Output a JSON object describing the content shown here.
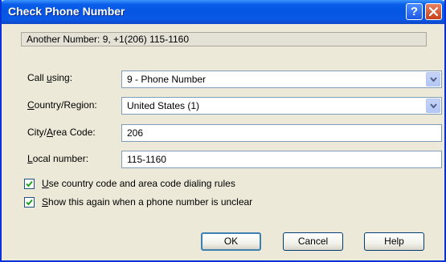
{
  "window": {
    "title": "Check Phone Number",
    "help_glyph": "?",
    "close_icon": "close-icon"
  },
  "info": {
    "text": "Another Number: 9, +1(206) 115-1160"
  },
  "form": {
    "call_using": {
      "label_pre": "Call ",
      "label_key": "u",
      "label_post": "sing:",
      "value": "9 - Phone Number"
    },
    "country": {
      "label_pre": "",
      "label_key": "C",
      "label_post": "ountry/Region:",
      "value": "United States (1)"
    },
    "area": {
      "label_pre": "City/",
      "label_key": "A",
      "label_post": "rea Code:",
      "value": "206"
    },
    "local": {
      "label_pre": "",
      "label_key": "L",
      "label_post": "ocal number:",
      "value": "115-1160"
    }
  },
  "options": {
    "dialing_rules": {
      "key": "U",
      "rest": "se country code and area code dialing rules",
      "checked": true
    },
    "show_again": {
      "key": "S",
      "rest": "how this again when a phone number is unclear",
      "checked": true
    }
  },
  "buttons": {
    "ok": "OK",
    "cancel": "Cancel",
    "help": "Help"
  },
  "colors": {
    "titlebar": "#0456e3",
    "dialog_bg": "#ece9d8",
    "checkbox_check": "#21a121"
  }
}
